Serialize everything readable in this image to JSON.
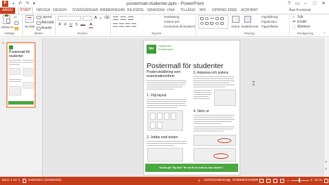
{
  "window": {
    "title": "postermall-studenter.pptx - PowerPoint",
    "app_icon": "P",
    "qat": {
      "save": "▪",
      "undo": "↶",
      "redo": "↷",
      "customize": "▾"
    },
    "controls": {
      "help": "?",
      "ribbon_options": "▭",
      "minimize": "–",
      "maximize": "□",
      "close": "✕"
    }
  },
  "ribbon": {
    "tabs": [
      "ARKIV",
      "START",
      "INFOGA",
      "DESIGN",
      "ÖVERGÅNGAR",
      "ANIMERINGAR",
      "BILDSPEL",
      "GRANSKA",
      "VISA",
      "TILLÄGG",
      "MIX",
      "ISPRING FREE",
      "ACROBAT"
    ],
    "active_tab": "START",
    "account": "Åsa Kronkvist",
    "groups": {
      "clipboard": {
        "label": "Urklipp",
        "paste": "Klistra in"
      },
      "slides": {
        "label": "Bilder",
        "new_slide": "Ny bild",
        "layout": "Layout",
        "reset": "Återställ",
        "section": "Avsnitt"
      },
      "font": {
        "label": "Tecken",
        "bold": "F",
        "italic": "K",
        "underline": "U",
        "shadow": "S",
        "strike": "abc",
        "color": "A"
      },
      "paragraph": {
        "label": "Stycke",
        "text_direction": "Textriktning",
        "align_text": "Justera text",
        "smartart": "Konvertera till SmartArt"
      },
      "drawing": {
        "label": "Ritning",
        "arrange": "Ordna",
        "quick_styles": "Snabbformat",
        "shape_fill": "Figurfyllning",
        "shape_outline": "Figurkontur",
        "shape_effects": "Figureffekter"
      },
      "editing": {
        "label": "Redigering",
        "find": "Sök",
        "replace": "Ersätt",
        "select": "Markera"
      }
    }
  },
  "thumbnails": [
    {
      "number": "1",
      "title": "Postermall för studenter"
    }
  ],
  "slide": {
    "org": "Högskolan Kristianstad",
    "logo": "hkr",
    "title": "Postermall för studenter",
    "subtitle": "Posterutställning som examinationsform",
    "section1": "1. Välj layout",
    "section2": "2. Jobba med texten",
    "section3": "3. Anpassa och justera",
    "section4": "4. Skriv ut",
    "footer": "Klicka på \"Ny bild\" för att få en mall du kan skriva 7."
  },
  "status": {
    "slide_position": "BILD 1 AV 1",
    "language": "SVENSKA (SVERIGE)",
    "notes": "ANTECKNINGAR",
    "comments": "KOMMENTARER",
    "zoom": "31 %"
  },
  "colors": {
    "brand": "#c43e1c",
    "slide_green": "#49a83f"
  }
}
